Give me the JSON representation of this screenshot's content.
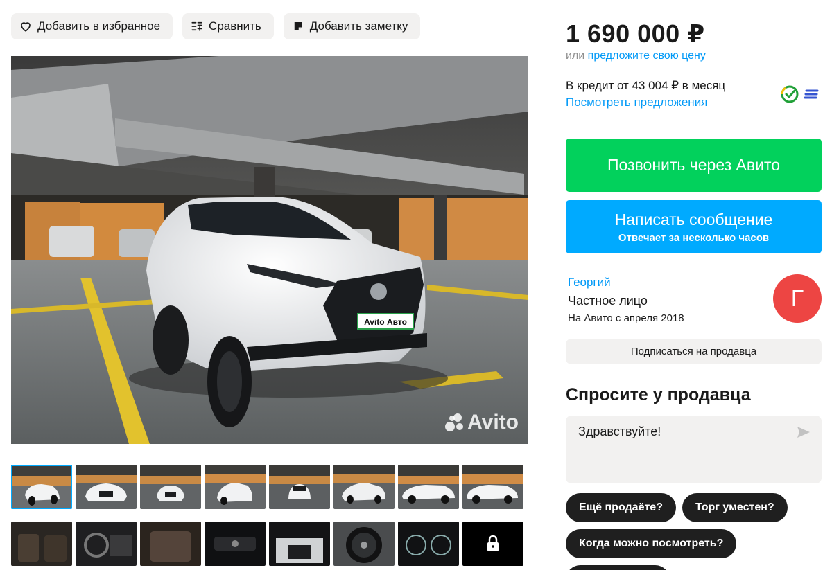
{
  "toolbar": {
    "favorite_label": "Добавить в избранное",
    "compare_label": "Сравнить",
    "note_label": "Добавить заметку"
  },
  "gallery": {
    "watermark": "Avito",
    "plate_text": "Avito Авто",
    "thumbnails_row1": [
      "photo-1",
      "photo-2",
      "photo-3",
      "photo-4",
      "photo-5",
      "photo-6",
      "photo-7",
      "photo-8"
    ],
    "thumbnails_row2": [
      "photo-9",
      "photo-10",
      "photo-11",
      "photo-12",
      "photo-13",
      "photo-14",
      "photo-15",
      "locked"
    ]
  },
  "price": {
    "value": "1 690 000 ₽",
    "offer_prefix": "или",
    "offer_link": "предложите свою цену"
  },
  "credit": {
    "text": "В кредит от 43 004 ₽ в месяц",
    "link": "Посмотреть предложения",
    "icons": [
      "sber-icon",
      "bank-stripes-icon"
    ]
  },
  "actions": {
    "call_label": "Позвонить через Авито",
    "message_label": "Написать сообщение",
    "message_sub": "Отвечает за несколько часов"
  },
  "seller": {
    "name": "Георгий",
    "type": "Частное лицо",
    "since": "На Авито с апреля 2018",
    "avatar_letter": "Г",
    "avatar_color": "#ed4543",
    "subscribe_label": "Подписаться на продавца"
  },
  "ask": {
    "title": "Спросите у продавца",
    "input_value": "Здравствуйте!",
    "chips": [
      "Ещё продаёте?",
      "Торг уместен?",
      "Когда можно посмотреть?"
    ]
  },
  "colors": {
    "call": "#02d15c",
    "message": "#00aaff",
    "link": "#0099f7"
  }
}
